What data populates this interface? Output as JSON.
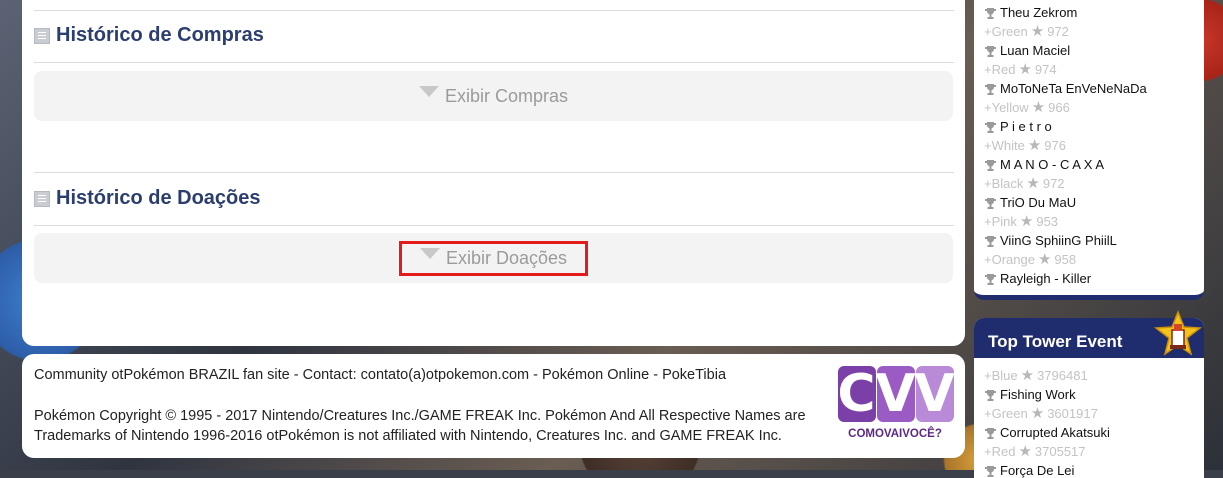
{
  "sections": {
    "compras": {
      "title": "Histórico de Compras",
      "button": "Exibir Compras"
    },
    "doacoes": {
      "title": "Histórico de Doações",
      "button": "Exibir Doações"
    }
  },
  "footer": {
    "line1": "Community otPokémon BRAZIL fan site - Contact: contato(a)otpokemon.com - Pokémon Online - PokeTibia",
    "line2a": "Pokémon Copyright © 1995 - 2017 Nintendo/Creatures Inc./GAME FREAK Inc. Pokémon And All Respective Names are",
    "line2b": "Trademarks of Nintendo 1996-2016 otPokémon is not affiliated with Nintendo, Creatures Inc. and GAME FREAK Inc.",
    "logo_text": "CVV",
    "logo_sub": "COMOVAIVOCÊ?",
    "logo_colors": [
      "#7b3fa8",
      "#9a5cc4",
      "#b88ad8"
    ]
  },
  "ranking": [
    {
      "name": "Theu Zekrom",
      "team": "+Green",
      "score": "972"
    },
    {
      "name": "Luan Maciel",
      "team": "+Red",
      "score": "974"
    },
    {
      "name": "MoToNeTa EnVeNeNaDa",
      "team": "+Yellow",
      "score": "966"
    },
    {
      "name": "P i e t r o",
      "team": "+White",
      "score": "976"
    },
    {
      "name": "M A N O - C A X A",
      "team": "+Black",
      "score": "972"
    },
    {
      "name": "TriO Du MaU",
      "team": "+Pink",
      "score": "953"
    },
    {
      "name": "ViinG SphiinG PhiilL",
      "team": "+Orange",
      "score": "958"
    },
    {
      "name": "Rayleigh - Killer",
      "team": "",
      "score": ""
    }
  ],
  "tower": {
    "title": "Top Tower Event",
    "entries": [
      {
        "team": "+Blue",
        "score": "3796481",
        "name": "Fishing Work"
      },
      {
        "team": "+Green",
        "score": "3601917",
        "name": "Corrupted Akatsuki"
      },
      {
        "team": "+Red",
        "score": "3705517",
        "name": "Força De Lei"
      }
    ]
  }
}
